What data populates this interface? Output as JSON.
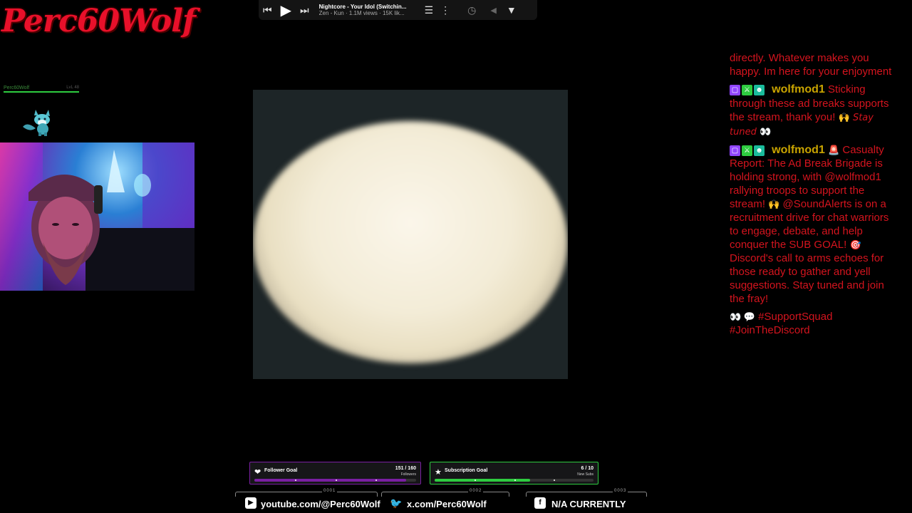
{
  "logo": {
    "text": "Perc60Wolf"
  },
  "mini_user": {
    "name": "Perc60Wolf",
    "level": "LvL 48"
  },
  "media_player": {
    "title": "Nightcore - Your Idol (Switchin...",
    "subtitle": "Zen - Kun · 1.1M views · 15K lik...",
    "prev_icon": "skip-previous-icon",
    "play_icon": "play-icon",
    "next_icon": "skip-next-icon"
  },
  "chat": {
    "username_color": "#c9a400",
    "text_color": "#d4141e",
    "messages": [
      {
        "user": "",
        "text": "directly. Whatever makes you happy. Im here for your enjoyment"
      },
      {
        "user": "wolfmod1",
        "text": "Sticking through these ad breaks supports the stream, thank you!",
        "tail_emote": "🙌",
        "tail_italic": "Stay tuned",
        "tail_emote2": "👀"
      },
      {
        "user": "wolfmod1",
        "user_emote": "🚨",
        "text": "Casualty Report: The Ad Break Brigade is holding strong, with @wolfmod1 rallying troops to support the stream!",
        "part2_emote": "🙌",
        "part2": "@SoundAlerts is on a recruitment drive for chat warriors to engage, debate, and help conquer the SUB GOAL!",
        "part3_emote": "🎯",
        "part3": "Discord's call to arms echoes for those ready to gather and yell suggestions. Stay tuned and join the fray!"
      },
      {
        "user": "",
        "lead_emotes": "👀 💬",
        "text": "#SupportSquad #JoinTheDiscord"
      }
    ]
  },
  "goals": {
    "follower": {
      "label": "Follower Goal",
      "count": "151 / 160",
      "unit": "Followers",
      "progress": 0.94,
      "color": "#7a1fa2"
    },
    "subscription": {
      "label": "Subscription Goal",
      "count": "6 / 10",
      "unit": "New Subs",
      "progress": 0.6,
      "color": "#2ecc40"
    }
  },
  "socials": [
    {
      "num": "0001",
      "icon": "youtube-icon",
      "text": "youtube.com/@Perc60Wolf"
    },
    {
      "num": "0002",
      "icon": "twitter-icon",
      "text": "x.com/Perc60Wolf"
    },
    {
      "num": "0003",
      "icon": "facebook-icon",
      "text": "N/A CURRENTLY"
    }
  ]
}
